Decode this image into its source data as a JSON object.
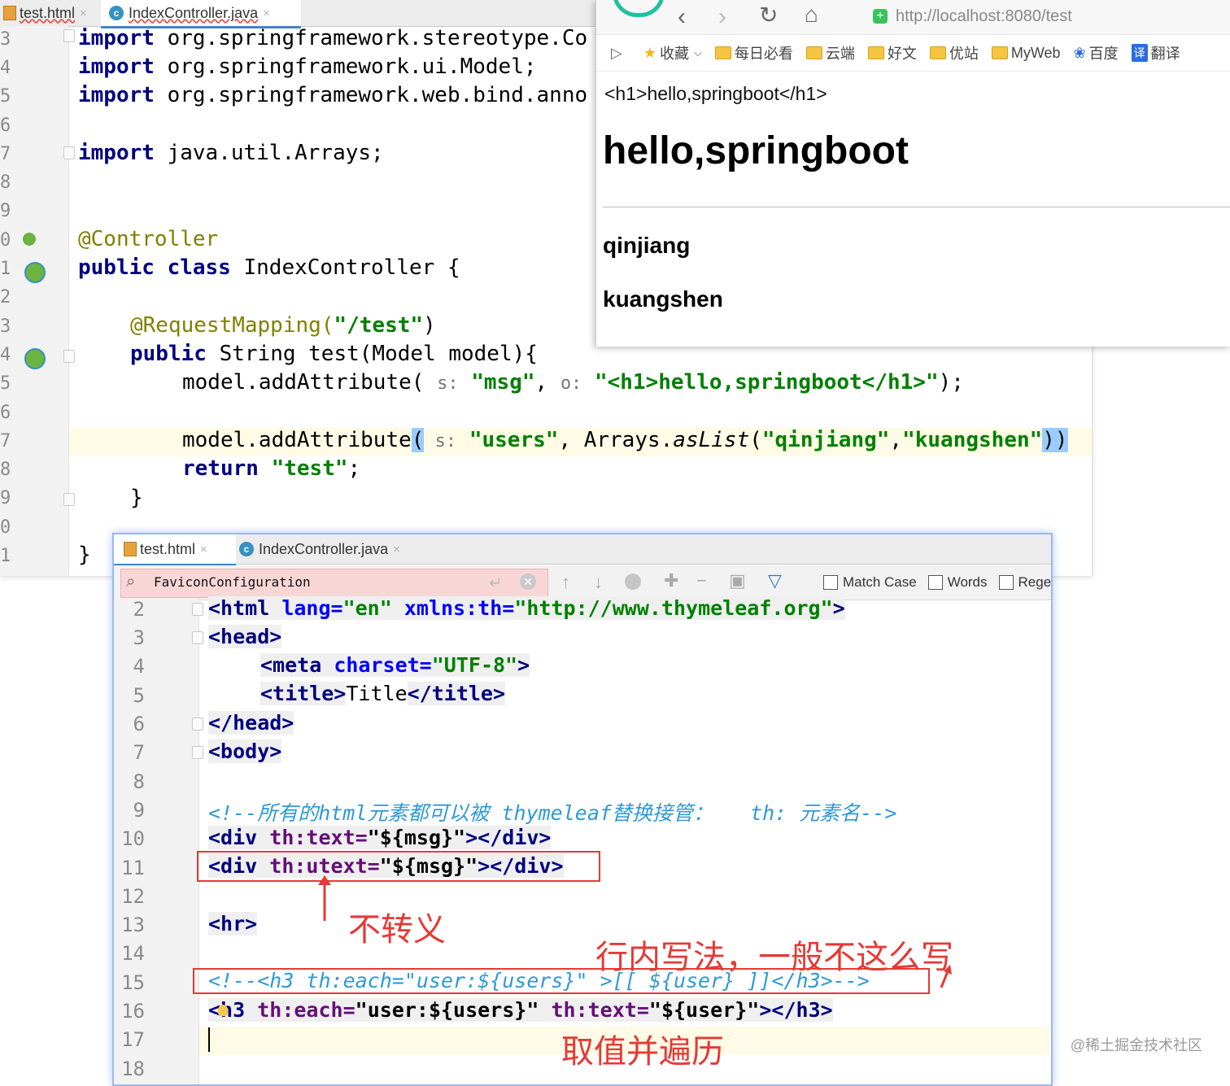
{
  "top_editor": {
    "tabs": [
      {
        "label": "test.html",
        "close": "×"
      },
      {
        "label": "IndexController.java",
        "close": "×"
      }
    ],
    "line_numbers": [
      "3",
      "4",
      "5",
      "6",
      "7",
      "8",
      "9",
      "0",
      "1",
      "2",
      "3",
      "4",
      "5",
      "6",
      "7",
      "8",
      "9",
      "0",
      "1"
    ],
    "code": {
      "l3_kw": "import",
      "l3_rest": " org.springframework.stereotype.Co",
      "l4_kw": "import",
      "l4_rest": " org.springframework.ui.Model;",
      "l5_kw": "import",
      "l5_rest": " org.springframework.web.bind.anno",
      "l7_kw": "import",
      "l7_rest": " java.util.Arrays;",
      "l10_ann": "@Controller",
      "l11_kw": "public class",
      "l11_rest": " IndexController {",
      "l13_ann": "@RequestMapping(",
      "l13_str": "\"/test\"",
      "l13_end": ")",
      "l14_kw": "public",
      "l14_rest": " String test(Model model){",
      "l15_a": "model.addAttribute( ",
      "l15_hint1": "s:",
      "l15_str1": " \"msg\"",
      "l15_b": ", ",
      "l15_hint2": "o:",
      "l15_str2": " \"<h1>hello,springboot</h1>\"",
      "l15_end": ");",
      "l17_a": "model.addAttribute",
      "l17_paren": "(",
      "l17_hint": " s:",
      "l17_str1": " \"users\"",
      "l17_b": ", Arrays.",
      "l17_method": "asList",
      "l17_c": "(",
      "l17_str2": "\"qinjiang\"",
      "l17_comma": ",",
      "l17_str3": "\"kuangshen\"",
      "l17_end": "))",
      "l18_kw": "return",
      "l18_str": " \"test\"",
      "l18_end": ";",
      "l19": "}",
      "l21": "}"
    }
  },
  "browser": {
    "url": "http://localhost:8080/test",
    "bookmarks": [
      "收藏",
      "每日必看",
      "云端",
      "好文",
      "优站",
      "MyWeb",
      "百度",
      "翻译"
    ],
    "escaped_text": "<h1>hello,springboot</h1>",
    "heading": "hello,springboot",
    "users": [
      "qinjiang",
      "kuangshen"
    ]
  },
  "bottom_editor": {
    "tabs": [
      {
        "label": "test.html",
        "close": "×"
      },
      {
        "label": "IndexController.java",
        "close": "×"
      }
    ],
    "search": {
      "value": "FaviconConfiguration",
      "match_case": "Match Case",
      "words": "Words",
      "regex": "Rege"
    },
    "line_numbers": [
      "2",
      "3",
      "4",
      "5",
      "6",
      "7",
      "8",
      "9",
      "10",
      "11",
      "12",
      "13",
      "14",
      "15",
      "16",
      "17",
      "18"
    ],
    "code": {
      "l2_t1": "<html ",
      "l2_a1": "lang=",
      "l2_v1": "\"en\"",
      "l2_a2": " xmlns:th=",
      "l2_v2": "\"http://www.thymeleaf.org\"",
      "l2_t2": ">",
      "l3": "<head>",
      "l4_t": "<meta ",
      "l4_a": "charset=",
      "l4_v": "\"UTF-8\"",
      "l4_e": ">",
      "l5_t1": "<title>",
      "l5_txt": "Title",
      "l5_t2": "</title>",
      "l6": "</head>",
      "l7": "<body>",
      "l9": "<!--所有的html元素都可以被 thymeleaf替换接管：   th: 元素名-->",
      "l10_t": "<div ",
      "l10_a": "th:text=",
      "l10_v": "\"${msg}\"",
      "l10_e": "></div>",
      "l11_t": "<div ",
      "l11_a": "th:utext=",
      "l11_v": "\"${msg}\"",
      "l11_e": "></div>",
      "l13": "<hr>",
      "l15": "<!--<h3 th:each=\"user:${users}\" >[[ ${user} ]]</h3>-->",
      "l16_t": "<h3 ",
      "l16_a1": "th:each=",
      "l16_v1": "\"user:${users}\"",
      "l16_a2": " th:text=",
      "l16_v2": "\"${user}\"",
      "l16_e": "></h3>"
    }
  },
  "annotations": {
    "no_escape": "不转义",
    "inline_syntax": "行内写法，一般不这么写",
    "get_and_iterate": "取值并遍历"
  },
  "watermark": "@稀土掘金技术社区",
  "colors": {
    "keyword": "#000080",
    "annotation": "#808000",
    "string": "#008000",
    "comment": "#2e9ad6",
    "red_note": "#e53935",
    "focus_border": "#9bb8ef"
  }
}
